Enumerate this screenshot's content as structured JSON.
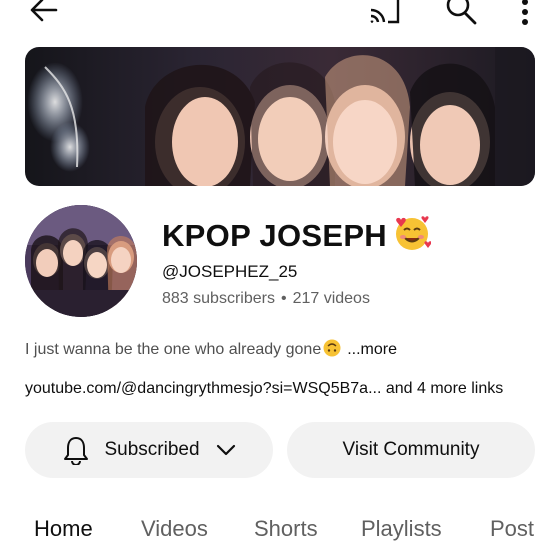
{
  "header": {
    "back_icon": "arrow-left-icon",
    "cast_icon": "cast-icon",
    "search_icon": "search-icon",
    "more_icon": "more-vertical-icon"
  },
  "channel": {
    "name": "KPOP JOSEPH",
    "name_emoji": "smiling-face-with-hearts-emoji",
    "handle": "@JOSEPHEZ_25",
    "subscribers": "883 subscribers",
    "separator": "•",
    "videos": "217 videos",
    "description": "I just wanna be the one who already gone",
    "description_emoji": "upside-down-face-emoji",
    "more_label": "...more",
    "links_text": "youtube.com/@dancingrythmesjo?si=WSQ5B7a... and 4 more links"
  },
  "actions": {
    "subscribed_label": "Subscribed",
    "community_label": "Visit Community"
  },
  "tabs": [
    {
      "label": "Home",
      "active": true
    },
    {
      "label": "Videos",
      "active": false
    },
    {
      "label": "Shorts",
      "active": false
    },
    {
      "label": "Playlists",
      "active": false
    },
    {
      "label": "Post",
      "active": false
    }
  ],
  "colors": {
    "background": "#ffffff",
    "pill": "#f2f2f2",
    "secondary_text": "#606060",
    "emoji": "#f7c234"
  }
}
